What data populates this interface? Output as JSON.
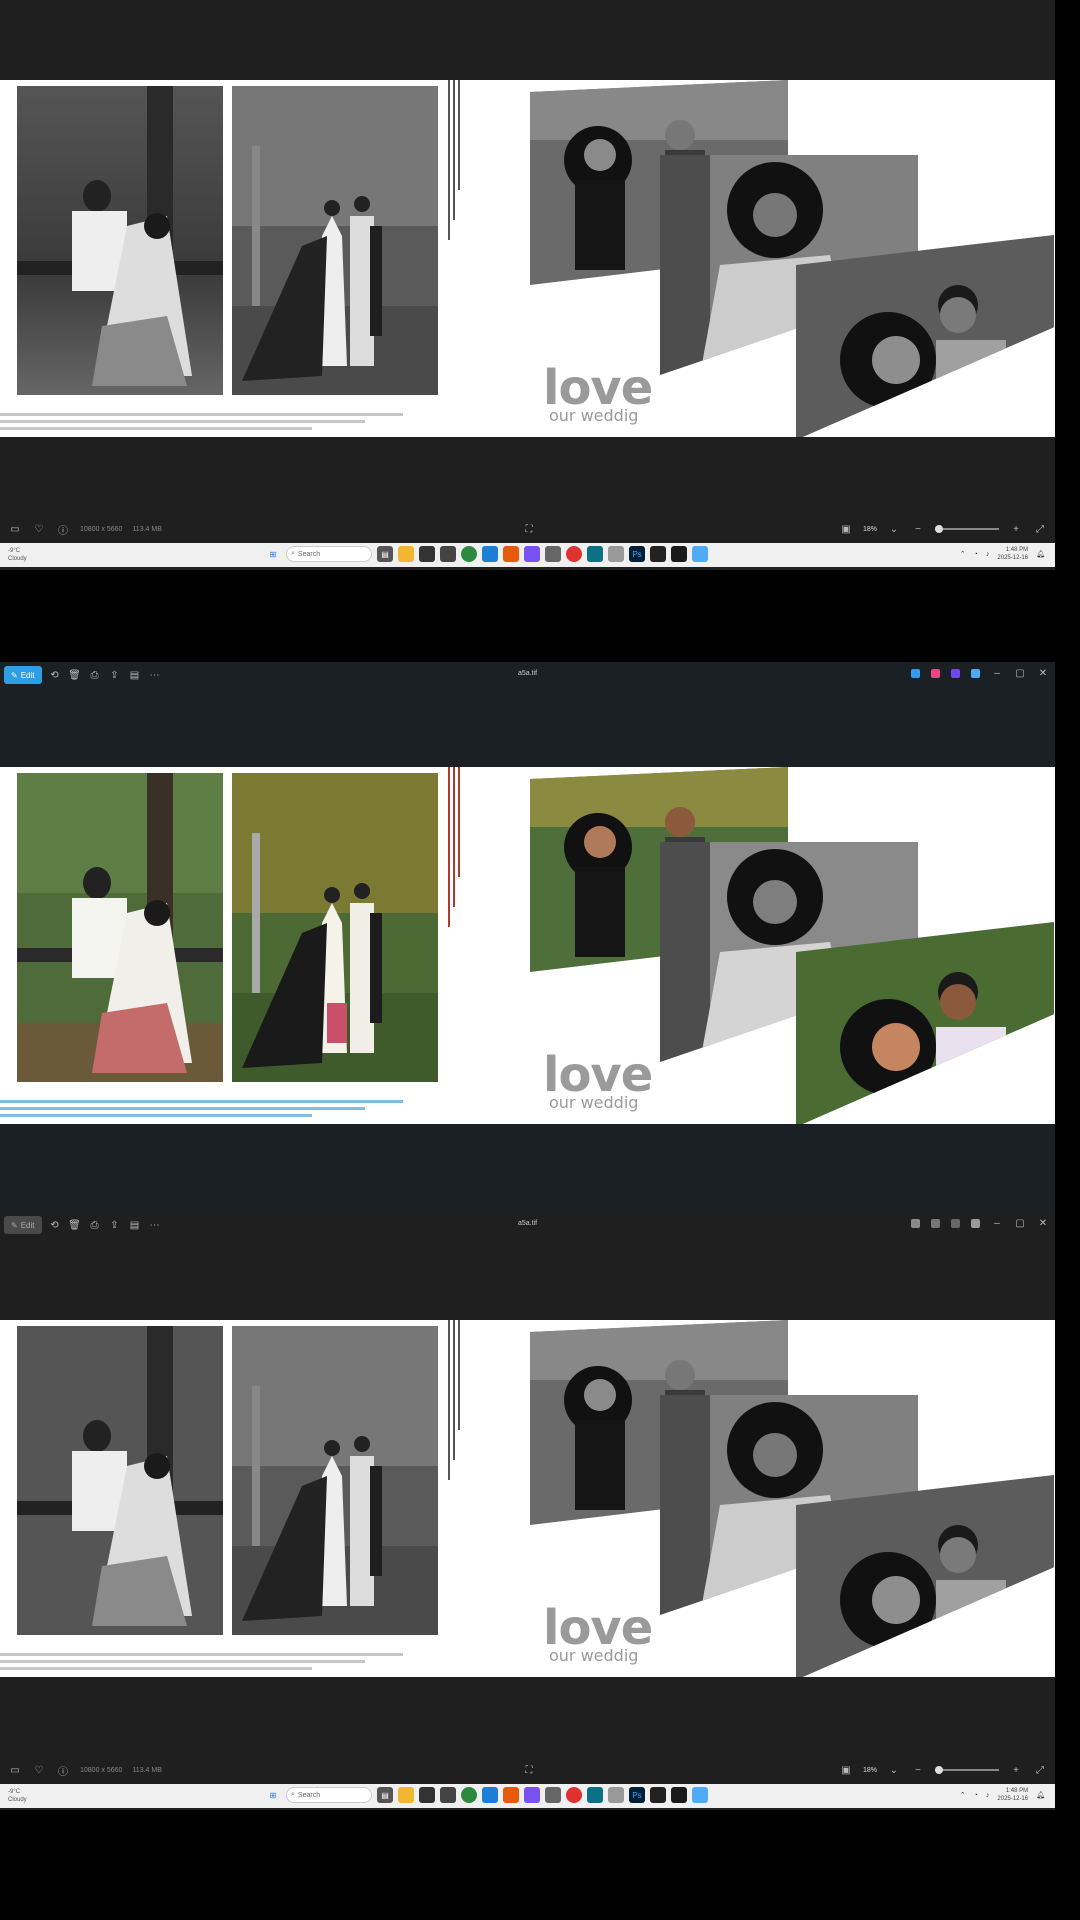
{
  "window": {
    "title": "a5a.tif",
    "edit_label": "Edit"
  },
  "spread": {
    "love_word": "love",
    "love_sub": "our weddig"
  },
  "statusbar": {
    "dimensions": "10800 x 5660",
    "file_size": "113.4 MB",
    "zoom": "18%"
  },
  "taskbar": {
    "weather_temp": "-9°C",
    "weather_desc": "Cloudy",
    "search_placeholder": "Search",
    "time": "1:48 PM",
    "date": "2025-12-16"
  },
  "colors": {
    "accent_blue": "#2e9ee6",
    "deco_red": "#b03a2e",
    "deco_blue": "#7fbde8",
    "deco_gray": "#9a9a9a"
  },
  "icons": [
    "edit-icon",
    "rotate-icon",
    "delete-icon",
    "print-icon",
    "share-icon",
    "info-panel-icon",
    "more-icon",
    "minimize-icon",
    "maximize-icon",
    "close-icon",
    "heart-icon",
    "info-icon",
    "fit-icon",
    "zoom-out-icon",
    "zoom-in-icon",
    "fullscreen-icon",
    "windows-start-icon",
    "search-icon"
  ]
}
